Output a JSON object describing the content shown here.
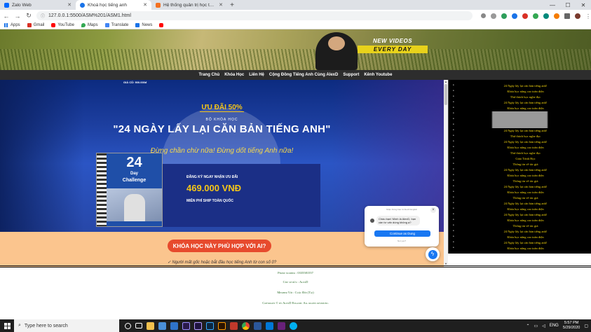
{
  "browser": {
    "tabs": [
      {
        "label": "Zalo Web",
        "active": false
      },
      {
        "label": "Khoá học tiếng anh",
        "active": true
      },
      {
        "label": "Hệ thống quản trị học tập Fpt Fr",
        "active": false
      }
    ],
    "url": "127.0.0.1:5500/ASM%201/ASM1.html",
    "bookmarks": [
      "Apps",
      "Gmail",
      "YouTube",
      "Maps",
      "Translate",
      "News"
    ]
  },
  "banner": {
    "new_videos": "NEW VIDEOS",
    "every_day": "EVERY DAY"
  },
  "menu": [
    "Trang Chủ",
    "Khóa Học",
    "Liên Hệ",
    "Cộng Đồng Tiếng Anh Cùng AlexD",
    "Support",
    "Kênh Youtube"
  ],
  "hero": {
    "price_top": "GIÁ CŨ: 900.000đ",
    "discount": "ƯU ĐÃI 50%",
    "kicker": "BỘ KHÓA HỌC",
    "title": "\"24 NGÀY LẤY LẠI CĂN BẢN TIẾNG ANH\"",
    "slogan": "Đừng chần chừ nữa! Đừng dốt tiếng Anh nữa!",
    "book": {
      "number": "24",
      "line1": "Day",
      "line2": "Challenge"
    },
    "offer_label": "ĐĂNG KÝ NGAY NHẬN ƯU ĐÃI",
    "offer_price": "469.000 VNĐ",
    "offer_ship": "MIỄN PHÍ SHIP TOÀN QUỐC"
  },
  "cta": {
    "button": "KHÓA HỌC NÀY PHÙ HỢP VỚI AI?",
    "note": "✓ Người mất gốc hoặc bắt đầu học tiếng Anh từ con số 0?"
  },
  "footer": {
    "phone": "Phone number : 0335581557",
    "address": "Chủ sở hữu : AlexD",
    "member": "Member Với : Cuộc Đời (Tài)",
    "copyright": "Copyright © by AlexD English. All rights reserved."
  },
  "sidebar": {
    "items": [
      "24 Ngày lấy lại căn bản tiếng anh!",
      "Khóa học nâng cao toàn diện",
      "Thử thách học nghe đọc",
      "24 Ngày lấy lại căn bản tiếng anh!",
      "Khóa học nâng cao toàn diện",
      "",
      "",
      "",
      "24 Ngày lấy lại căn bản tiếng anh!",
      "Thử thách học nghe đọc",
      "24 Ngày lấy lại căn bản tiếng anh!",
      "Khóa học nâng cao toàn diện",
      "Thử thách học nghe đọc",
      "Giáo Trình Học",
      "Thông tin về tác giả",
      "24 Ngày lấy lại căn bản tiếng anh!",
      "Khóa học nâng cao toàn diện",
      "Thông tin về tác giả",
      "24 Ngày lấy lại căn bản tiếng anh!",
      "Khóa học nâng cao toàn diện",
      "Thông tin về tác giả",
      "24 Ngày lấy lại căn bản tiếng anh!",
      "Khóa học nâng cao toàn diện",
      "24 Ngày lấy lại căn bản tiếng anh!",
      "Khóa học nâng cao toàn diện",
      "Thông tin về tác giả",
      "24 Ngày lấy lại căn bản tiếng anh!",
      "Khóa học nâng cao toàn diện",
      "24 Ngày lấy lại căn bản tiếng anh!",
      "Khóa học nâng cao toàn diện"
    ]
  },
  "messenger": {
    "header": "Nhận thông báo từ AlexD English",
    "message": "Chào bạn! Mình là AlexD, bạn cần tư vấn dùng không ạ?",
    "continue": "Continue as Dung",
    "not_now": "Not you?"
  },
  "taskbar": {
    "search_placeholder": "Type here to search",
    "lang": "ENG",
    "time": "5:57 PM",
    "date": "5/29/2020"
  }
}
